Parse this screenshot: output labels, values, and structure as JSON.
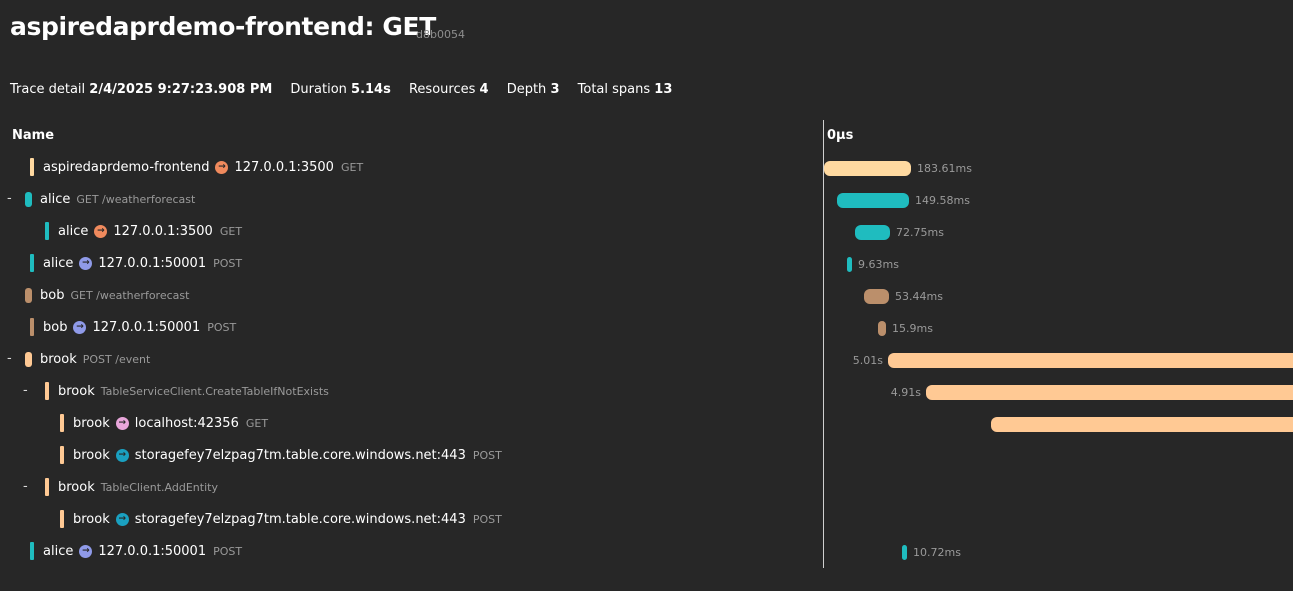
{
  "page": {
    "title": "aspiredaprdemo-frontend: GET",
    "trace_id": "d8b0054"
  },
  "summary": {
    "trace_detail_label": "Trace detail",
    "trace_detail_value": "2/4/2025 9:27:23.908 PM",
    "duration_label": "Duration",
    "duration_value": "5.14s",
    "resources_label": "Resources",
    "resources_value": "4",
    "depth_label": "Depth",
    "depth_value": "3",
    "total_spans_label": "Total spans",
    "total_spans_value": "13"
  },
  "headers": {
    "name": "Name",
    "timeline_start": "0µs"
  },
  "toggle_symbol": "-",
  "colors": {
    "frontend": "#ffd9a0",
    "alice": "#1fbcbf",
    "bob": "#bb8f6b",
    "brook": "#ffc994",
    "arrow_orange": "#f08a5d",
    "arrow_blue": "#8f9ae8",
    "arrow_pink": "#e8a6da",
    "arrow_teal": "#1aa0c0"
  },
  "spans": [
    {
      "service": "aspiredaprdemo-frontend",
      "peer": "127.0.0.1:3500",
      "method": "GET",
      "duration": "183.61ms"
    },
    {
      "service": "alice",
      "name": "GET /weatherforecast",
      "duration": "149.58ms"
    },
    {
      "service": "alice",
      "peer": "127.0.0.1:3500",
      "method": "GET",
      "duration": "72.75ms"
    },
    {
      "service": "alice",
      "peer": "127.0.0.1:50001",
      "method": "POST",
      "duration": "9.63ms"
    },
    {
      "service": "bob",
      "name": "GET /weatherforecast",
      "duration": "53.44ms"
    },
    {
      "service": "bob",
      "peer": "127.0.0.1:50001",
      "method": "POST",
      "duration": "15.9ms"
    },
    {
      "service": "brook",
      "name": "POST /event",
      "duration": "5.01s"
    },
    {
      "service": "brook",
      "name": "TableServiceClient.CreateTableIfNotExists",
      "duration": "4.91s"
    },
    {
      "service": "brook",
      "peer": "localhost:42356",
      "method": "GET"
    },
    {
      "service": "brook",
      "peer": "storagefey7elzpag7tm.table.core.windows.net:443",
      "method": "POST"
    },
    {
      "service": "brook",
      "name": "TableClient.AddEntity"
    },
    {
      "service": "brook",
      "peer": "storagefey7elzpag7tm.table.core.windows.net:443",
      "method": "POST"
    },
    {
      "service": "alice",
      "peer": "127.0.0.1:50001",
      "method": "POST",
      "duration": "10.72ms"
    }
  ]
}
